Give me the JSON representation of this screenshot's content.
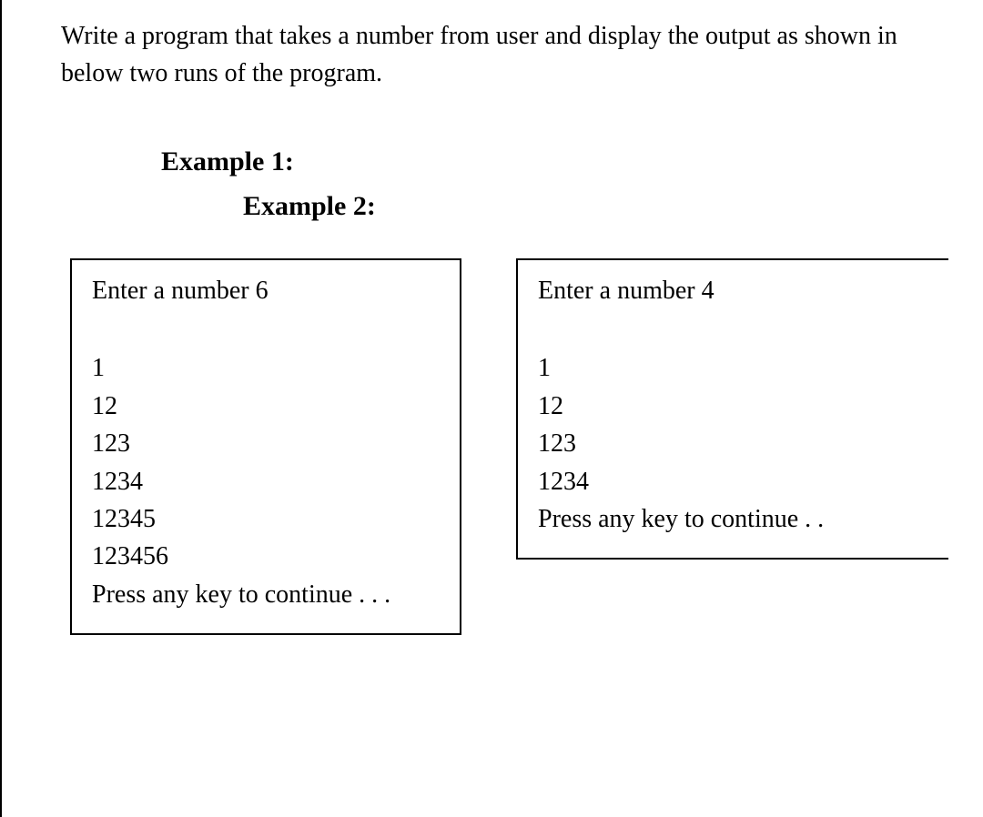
{
  "description": "Write a program that takes a number from user and display the output as shown in below two runs of the program.",
  "example1_label": "Example 1:",
  "example2_label": "Example 2:",
  "box1": {
    "input_line": "Enter a number 6",
    "lines": [
      "1",
      "12",
      "123",
      "1234",
      "12345",
      "123456"
    ],
    "press": "Press any key to continue . . ."
  },
  "box2": {
    "input_line": "Enter a number 4",
    "lines": [
      "1",
      "12",
      "123",
      "1234"
    ],
    "press": "Press any key to continue . ."
  }
}
